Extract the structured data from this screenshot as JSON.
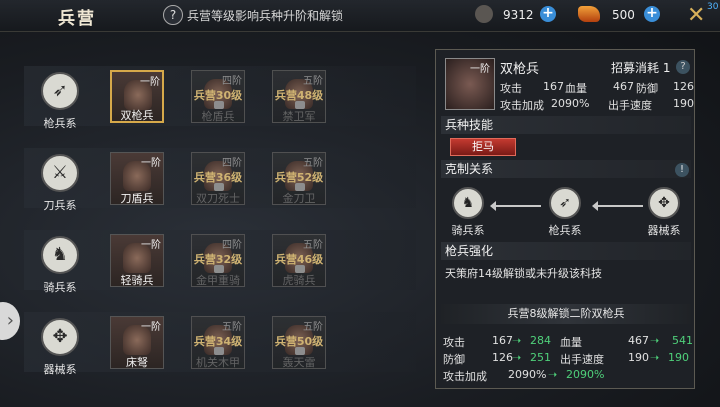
{
  "header": {
    "title": "兵营",
    "hint": "兵营等级影响兵种升阶和解锁",
    "res1": "9312",
    "res2": "500",
    "badge": "30"
  },
  "rows": [
    {
      "cat": "枪兵系",
      "icon": "➶",
      "cards": [
        {
          "tier": "一阶",
          "req": "",
          "name": "双枪兵",
          "on": true,
          "sel": true
        },
        {
          "tier": "四阶",
          "req": "兵营30级",
          "name": "枪盾兵",
          "on": false
        },
        {
          "tier": "五阶",
          "req": "兵营48级",
          "name": "禁卫军",
          "on": false
        }
      ]
    },
    {
      "cat": "刀兵系",
      "icon": "⚔",
      "cards": [
        {
          "tier": "一阶",
          "req": "",
          "name": "刀盾兵",
          "on": true
        },
        {
          "tier": "四阶",
          "req": "兵营36级",
          "name": "双刀死士",
          "on": false
        },
        {
          "tier": "五阶",
          "req": "兵营52级",
          "name": "金刀卫",
          "on": false
        }
      ]
    },
    {
      "cat": "骑兵系",
      "icon": "♞",
      "cards": [
        {
          "tier": "一阶",
          "req": "",
          "name": "轻骑兵",
          "on": true
        },
        {
          "tier": "四阶",
          "req": "兵营32级",
          "name": "金甲重骑",
          "on": false
        },
        {
          "tier": "五阶",
          "req": "兵营46级",
          "name": "虎骑兵",
          "on": false
        }
      ]
    },
    {
      "cat": "器械系",
      "icon": "✥",
      "cards": [
        {
          "tier": "一阶",
          "req": "",
          "name": "床弩",
          "on": true
        },
        {
          "tier": "五阶",
          "req": "兵营34级",
          "name": "机关木甲",
          "on": false
        },
        {
          "tier": "五阶",
          "req": "兵营50级",
          "name": "轰天雷",
          "on": false
        }
      ]
    }
  ],
  "panel": {
    "tier": "一阶",
    "name": "双枪兵",
    "recruit": "招募消耗 1",
    "atk_l": "攻击",
    "atk": "167",
    "hp_l": "血量",
    "hp": "467",
    "def_l": "防御",
    "def": "126",
    "atkp_l": "攻击加成",
    "atkp": "2090%",
    "spd_l": "出手速度",
    "spd": "190",
    "skills_h": "兵种技能",
    "skill": "拒马",
    "counter_h": "克制关系",
    "rel": [
      {
        "n": "骑兵系",
        "i": "♞"
      },
      {
        "n": "枪兵系",
        "i": "➶"
      },
      {
        "n": "器械系",
        "i": "✥"
      }
    ],
    "strength_h": "枪兵强化",
    "strength": "天策府14级解锁或未升级该科技",
    "unlock": "兵营8级解锁二阶双枪兵",
    "upg": [
      {
        "l": "攻击",
        "a": "167",
        "b": "284"
      },
      {
        "l": "血量",
        "a": "467",
        "b": "541"
      },
      {
        "l": "防御",
        "a": "126",
        "b": "251"
      },
      {
        "l": "出手速度",
        "a": "190",
        "b": "190"
      },
      {
        "l": "攻击加成",
        "a": "2090%",
        "b": "2090%"
      }
    ]
  },
  "colors": {
    "accent": "#d6a94a",
    "skill": "#c43a30",
    "up": "#4fd07a"
  }
}
